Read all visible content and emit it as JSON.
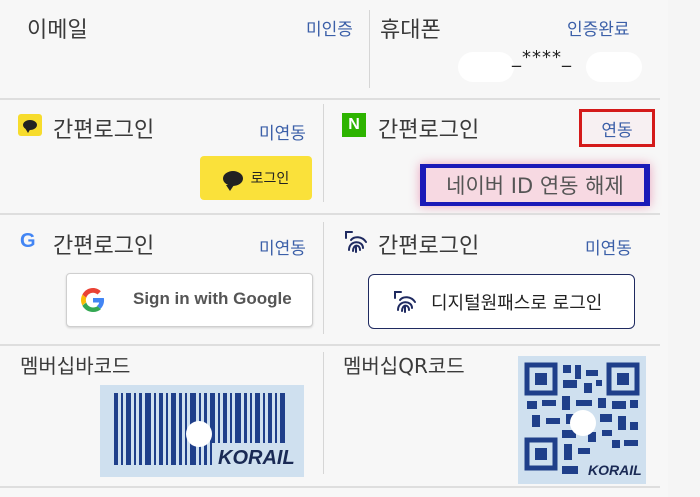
{
  "email": {
    "label": "이메일",
    "status": "미인증"
  },
  "phone": {
    "label": "휴대폰",
    "status": "인증완료",
    "masked_number": "_****_"
  },
  "kakao": {
    "label": "간편로그인",
    "status": "미연동",
    "button_label": "로그인"
  },
  "naver": {
    "label": "간편로그인",
    "link_label": "연동",
    "unlink_label": "네이버 ID 연동 해제"
  },
  "google": {
    "label": "간편로그인",
    "status": "미연동",
    "button_label": "Sign in with Google"
  },
  "digital_pass": {
    "label": "간편로그인",
    "status": "미연동",
    "button_label": "디지털원패스로 로그인"
  },
  "membership_barcode": {
    "label": "멤버십바코드",
    "brand": "KORAIL"
  },
  "membership_qr": {
    "label": "멤버십QR코드",
    "brand": "KORAIL"
  },
  "colors": {
    "status_link": "#3b5fa8",
    "kakao_yellow": "#fae13a",
    "naver_green": "#2db400",
    "highlight_red": "#d41a1a",
    "highlight_blue": "#1a1ab8",
    "pass_navy": "#1f2a60"
  },
  "icons": {
    "kakao": "kakao-talk-bubble-icon",
    "naver": "naver-n-icon",
    "google": "google-g-icon",
    "pass": "fingerprint-icon"
  }
}
